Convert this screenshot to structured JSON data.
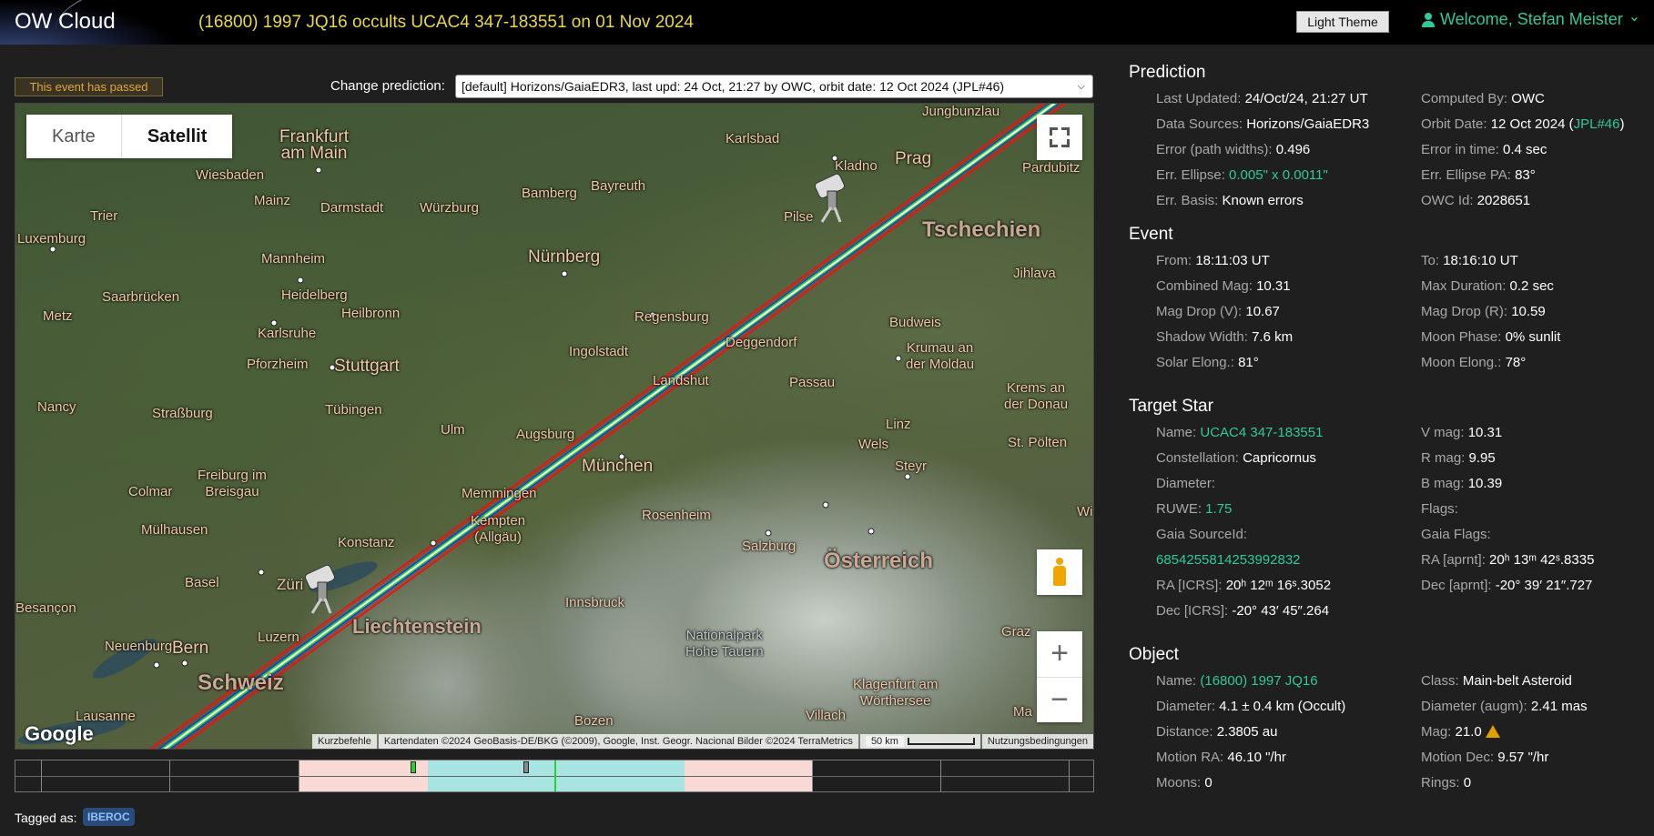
{
  "header": {
    "brand": "OW Cloud",
    "title": "(16800) 1997 JQ16 occults UCAC4 347-183551 on 01 Nov 2024",
    "theme_button": "Light Theme",
    "welcome": "Welcome, Stefan Meister",
    "welcome_chevron": "⌄"
  },
  "status_badge": "This event has passed",
  "prediction_select": {
    "label": "Change prediction:",
    "value": "[default] Horizons/GaiaEDR3, last upd: 24 Oct, 21:27 by OWC, orbit date: 12 Oct 2024 (JPL#46)"
  },
  "map": {
    "type_tabs": [
      "Karte",
      "Satellit"
    ],
    "active_tab": "Satellit",
    "zoom_in": "+",
    "zoom_out": "−",
    "logo": "Google",
    "footer": {
      "shortcuts": "Kurzbefehle",
      "attribution": "Kartendaten ©2024 GeoBasis-DE/BKG (©2009), Google, Inst. Geogr. Nacional Bilder ©2024 TerraMetrics",
      "scale": "50 km",
      "terms": "Nutzungsbedingungen"
    },
    "labels": {
      "frankfurt": "Frankfurt\nam Main",
      "wiesbaden": "Wiesbaden",
      "mainz": "Mainz",
      "darmstadt": "Darmstadt",
      "trier": "Trier",
      "luxemburg": "Luxemburg",
      "mannheim": "Mannheim",
      "heidelberg": "Heidelberg",
      "saarbruecken": "Saarbrücken",
      "metz": "Metz",
      "heilbronn": "Heilbronn",
      "karlsruhe": "Karlsruhe",
      "pforzheim": "Pforzheim",
      "stuttgart": "Stuttgart",
      "nancy": "Nancy",
      "strassburg": "Straßburg",
      "tuebingen": "Tübingen",
      "ulm": "Ulm",
      "augsburg": "Augsburg",
      "muenchen": "München",
      "freiburg": "Freiburg im\nBreisgau",
      "colmar": "Colmar",
      "muelhausen": "Mülhausen",
      "basel": "Basel",
      "besancon": "Besançon",
      "zuerich": "Züri",
      "konstanz": "Konstanz",
      "memmingen": "Memmingen",
      "kempten": "Kempten\n(Allgäu)",
      "neuenburg": "Neuenburg",
      "bern": "Bern",
      "luzern": "Luzern",
      "lausanne": "Lausanne",
      "schweiz": "Schweiz",
      "liechtenstein": "Liechtenstein",
      "bamberg": "Bamberg",
      "bayreuth": "Bayreuth",
      "wuerzburg": "Würzburg",
      "nuernberg": "Nürnberg",
      "karlsbad": "Karlsbad",
      "kladno": "Kladno",
      "prag": "Prag",
      "pilsen": "Pilse",
      "pardubitz": "Pardubitz",
      "tschechien": "Tschechien",
      "jihlava": "Jihlava",
      "budweis": "Budweis",
      "krumau": "Krumau an\nder Moldau",
      "regensburg": "Regensburg",
      "deggendorf": "Deggendorf",
      "ingolstadt": "Ingolstadt",
      "landshut": "Landshut",
      "passau": "Passau",
      "krems": "Krems an\nder Donau",
      "linz": "Linz",
      "wels": "Wels",
      "stpoelten": "St. Pölten",
      "steyr": "Steyr",
      "rosenheim": "Rosenheim",
      "salzburg": "Salzburg",
      "oesterreich": "Österreich",
      "innsbruck": "Innsbruck",
      "nationalpark": "Nationalpark\nHohe Tauern",
      "klagenfurt": "Klagenfurt am\nWörthersee",
      "villach": "Villach",
      "bozen": "Bozen",
      "graz": "Graz",
      "jungbunzlau": "Jungbunzlau",
      "wi": "Wi",
      "ma": "Ma"
    }
  },
  "tagged": {
    "label": "Tagged as:",
    "tag": "IBEROC"
  },
  "prediction": {
    "title": "Prediction",
    "rows": [
      {
        "k": "Last Updated:",
        "v": "24/Oct/24, 21:27 UT"
      },
      {
        "k": "Computed By:",
        "v": "OWC"
      },
      {
        "k": "Data Sources:",
        "v": "Horizons/GaiaEDR3"
      },
      {
        "k": "Orbit Date:",
        "v": "12 Oct 2024 (",
        "link": "JPL#46",
        "tail": ")"
      },
      {
        "k": "Error (path widths):",
        "v": "0.496"
      },
      {
        "k": "Error in time:",
        "v": "0.4 sec"
      },
      {
        "k": "Err. Ellipse:",
        "link": "0.005\" x 0.0011\""
      },
      {
        "k": "Err. Ellipse PA:",
        "v": "83°"
      },
      {
        "k": "Err. Basis:",
        "v": "Known errors"
      },
      {
        "k": "OWC Id:",
        "v": "2028651"
      }
    ]
  },
  "event": {
    "title": "Event",
    "rows": [
      {
        "k": "From:",
        "v": "18:11:03 UT"
      },
      {
        "k": "To:",
        "v": "18:16:10 UT"
      },
      {
        "k": "Combined Mag:",
        "v": "10.31"
      },
      {
        "k": "Max Duration:",
        "v": "0.2 sec"
      },
      {
        "k": "Mag Drop (V):",
        "v": "10.67"
      },
      {
        "k": "Mag Drop (R):",
        "v": "10.59"
      },
      {
        "k": "Shadow Width:",
        "v": "7.6 km"
      },
      {
        "k": "Moon Phase:",
        "v": "0% sunlit"
      },
      {
        "k": "Solar Elong.:",
        "v": "81°"
      },
      {
        "k": "Moon Elong.:",
        "v": "78°"
      }
    ]
  },
  "target_star": {
    "title": "Target Star",
    "rows": [
      {
        "k": "Name:",
        "link": "UCAC4 347-183551"
      },
      {
        "k": "V mag:",
        "v": "10.31"
      },
      {
        "k": "Constellation:",
        "v": "Capricornus"
      },
      {
        "k": "R mag:",
        "v": "9.95"
      },
      {
        "k": "Diameter:",
        "v": ""
      },
      {
        "k": "B mag:",
        "v": "10.39"
      },
      {
        "k": "RUWE:",
        "link": "1.75"
      },
      {
        "k": "Flags:",
        "v": ""
      },
      {
        "k": "Gaia SourceId:",
        "v": ""
      },
      {
        "k": "Gaia Flags:",
        "v": ""
      },
      {
        "k": "",
        "link": "6854255814253992832"
      },
      {
        "k": "RA [aprnt]:",
        "v": "20ʰ 13ᵐ 42ˢ.8335"
      },
      {
        "k": "RA [ICRS]:",
        "v": "20ʰ 12ᵐ 16ˢ.3052"
      },
      {
        "k": "Dec [aprnt]:",
        "v": "-20° 39′ 21″.727"
      },
      {
        "k": "Dec [ICRS]:",
        "v": "-20° 43′ 45″.264"
      }
    ]
  },
  "object": {
    "title": "Object",
    "rows": [
      {
        "k": "Name:",
        "link": "(16800) 1997 JQ16"
      },
      {
        "k": "Class:",
        "v": "Main-belt Asteroid"
      },
      {
        "k": "Diameter:",
        "v": "4.1 ± 0.4 km  (Occult)"
      },
      {
        "k": "Diameter (augm):",
        "v": "2.41 mas"
      },
      {
        "k": "Distance:",
        "v": "2.3805 au"
      },
      {
        "k": "Mag:",
        "v": "21.0"
      },
      {
        "k": "Motion RA:",
        "v": "46.10 \"/hr"
      },
      {
        "k": "Motion Dec:",
        "v": "9.57 \"/hr"
      },
      {
        "k": "Moons:",
        "v": "0"
      },
      {
        "k": "Rings:",
        "v": "0"
      }
    ]
  },
  "colors": {
    "accent": "#2fc99a",
    "title_yellow": "#e8d84a",
    "path_red": "#e01818",
    "path_blue": "#1a3ae0",
    "path_green": "#2ad12a",
    "timeline_pink": "#f9d9d6",
    "timeline_cyan": "#a8e4e2"
  }
}
